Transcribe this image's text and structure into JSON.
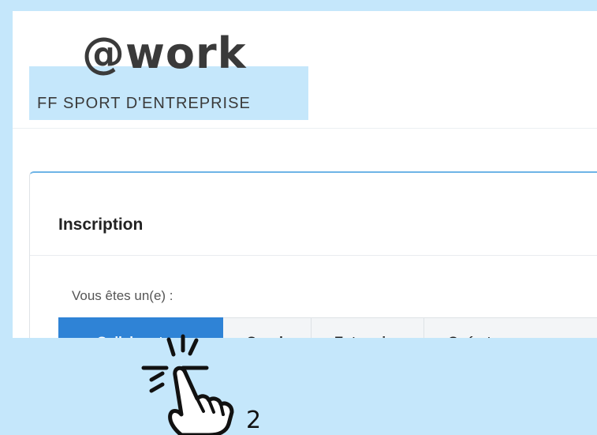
{
  "logo": {
    "mark": "@work",
    "subtitle": "FF SPORT D'ENTREPRISE"
  },
  "card": {
    "title": "Inscription",
    "question": "Vous êtes un(e) :",
    "tabs": [
      {
        "label": "Collaborateur",
        "active": true
      },
      {
        "label": "Coach",
        "active": false
      },
      {
        "label": "Entreprise",
        "active": false
      },
      {
        "label": "Opérateur spo",
        "active": false
      }
    ]
  },
  "annotation": {
    "step_number": "2",
    "icon": "pointing-hand-click-icon"
  },
  "colors": {
    "background": "#c5e7fb",
    "accent": "#2f83d6",
    "card_top_border": "#6eb4e6"
  }
}
